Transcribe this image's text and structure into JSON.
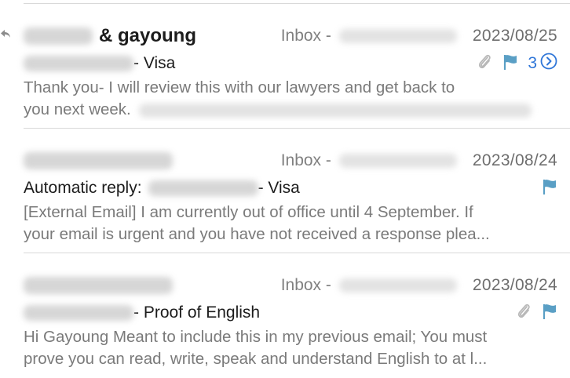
{
  "colors": {
    "flag": "#5a9fc5",
    "thread_count": "#2f76d8",
    "secondary_text": "#7a7a7a"
  },
  "messages": [
    {
      "sender_suffix": "& gayoung",
      "mailbox_prefix": "Inbox -",
      "date": "2023/08/25",
      "subject": "- Visa",
      "preview_line1": "Thank you- I will review this with our lawyers and get back to",
      "preview_line2": "you next week.",
      "thread_count": "3",
      "icons": [
        "reply-icon",
        "paperclip-icon",
        "flag-icon",
        "chevron-right-circle-icon"
      ]
    },
    {
      "mailbox_prefix": "Inbox -",
      "date": "2023/08/24",
      "subject_prefix": "Automatic reply:",
      "subject": "- Visa",
      "preview_line1": "[External Email] I am currently out of office until 4 September. If",
      "preview_line2": "your email is urgent and you have not received a response plea...",
      "icons": [
        "flag-icon"
      ]
    },
    {
      "mailbox_prefix": "Inbox -",
      "date": "2023/08/24",
      "subject": "- Proof of English",
      "preview_line1": "Hi Gayoung Meant to include this in my previous email; You must",
      "preview_line2": "prove you can read, write, speak and understand English to at l...",
      "icons": [
        "paperclip-icon",
        "flag-icon"
      ]
    }
  ]
}
